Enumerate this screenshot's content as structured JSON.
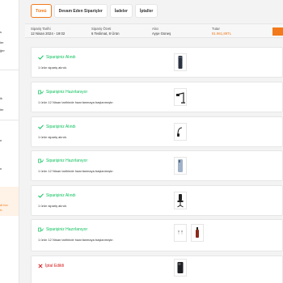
{
  "sidebar": {
    "fragments": [
      "s",
      "ler",
      "ğer",
      "ik",
      "ler",
      "n",
      "n"
    ],
    "promo_lines": [
      "di fon",
      "ir."
    ]
  },
  "tabs": [
    {
      "label": "Tümü",
      "active": true
    },
    {
      "label": "Devam Eden Siparişler",
      "active": false
    },
    {
      "label": "İadeler",
      "active": false
    },
    {
      "label": "İptaller",
      "active": false
    }
  ],
  "summary": {
    "date_label": "Sipariş Tarihi",
    "date_value": "12 Nisan 2024 - 19:02",
    "overview_label": "Sipariş Özeti",
    "overview_value": "6 Teslimat, 8 Ürün",
    "buyer_label": "Alıcı",
    "buyer_value": "Ayşe Güneş",
    "total_label": "Tutar",
    "total_value": "81.961,89TL"
  },
  "orders": [
    {
      "status": "Siparişiniz Alındı",
      "type": "received",
      "note": "1 ürün sipariş alındı.",
      "products": [
        "phone"
      ]
    },
    {
      "status": "Siparişiniz Hazırlanıyor",
      "type": "preparing",
      "note": "1 ürün 12 Nisan tarihinde hazırlanmaya başlanmıştır.",
      "products": [
        "desk-lamp"
      ]
    },
    {
      "status": "Siparişiniz Alındı",
      "type": "received",
      "note": "1 ürün sipariş alındı.",
      "products": [
        "headphones"
      ]
    },
    {
      "status": "Siparişiniz Hazırlanıyor",
      "type": "preparing",
      "note": "1 ürün 12 Nisan tarihinde hazırlanmaya başlanmıştır.",
      "products": [
        "phone-case"
      ]
    },
    {
      "status": "Siparişiniz Alındı",
      "type": "received",
      "note": "1 ürün sipariş alındı.",
      "products": [
        "office-chair"
      ]
    },
    {
      "status": "Siparişiniz Hazırlanıyor",
      "type": "preparing",
      "note": "1 ürün 12 Nisan tarihinde hazırlanmaya başlanmıştır.",
      "products": [
        "earrings",
        "bottle"
      ]
    },
    {
      "status": "İptal Edildi",
      "type": "cancelled",
      "note": "",
      "products": [
        "phone-dark"
      ]
    }
  ],
  "colors": {
    "accent": "#f27a1a",
    "success": "#0bc15c",
    "danger": "#d21313"
  }
}
